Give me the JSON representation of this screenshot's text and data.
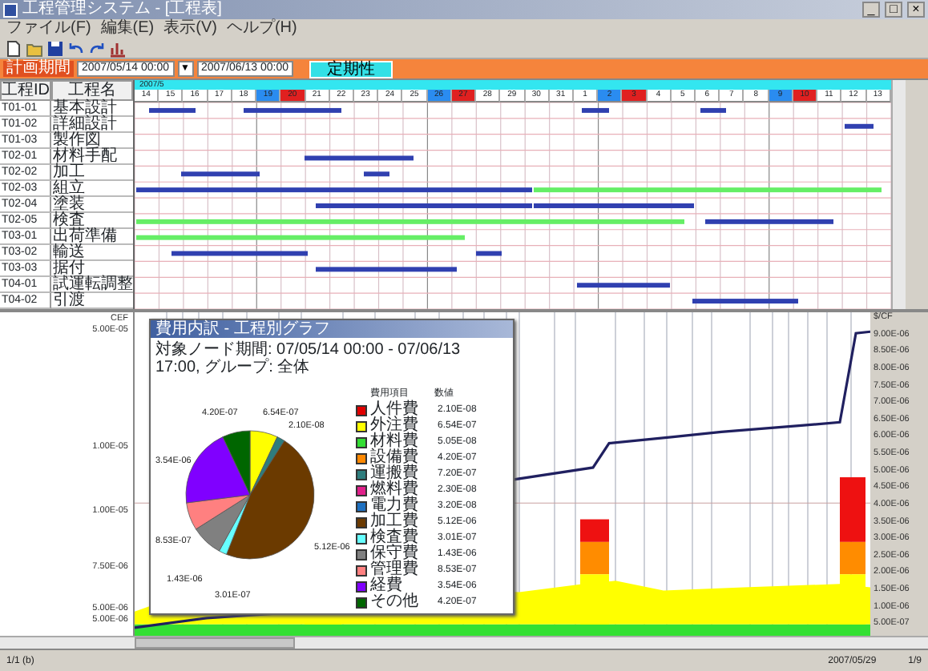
{
  "window": {
    "title": "工程管理システム - [工程表]",
    "controls": [
      "_",
      "□",
      "×"
    ]
  },
  "menu": [
    "ファイル(F)",
    "編集(E)",
    "表示(V)",
    "ヘルプ(H)"
  ],
  "filter_bar": {
    "label": "計画期間",
    "from": "2007/05/14 00:00",
    "dropdown": "▼",
    "to": "2007/06/13 00:00",
    "button": "定期性"
  },
  "gantt": {
    "columns": [
      "工程ID",
      "工程名"
    ],
    "month": "2007/5",
    "days": [
      {
        "label": "14",
        "kind": "weekday"
      },
      {
        "label": "15",
        "kind": "weekday"
      },
      {
        "label": "16",
        "kind": "weekday"
      },
      {
        "label": "17",
        "kind": "weekday"
      },
      {
        "label": "18",
        "kind": "weekday"
      },
      {
        "label": "19",
        "kind": "saturday"
      },
      {
        "label": "20",
        "kind": "sunday"
      },
      {
        "label": "21",
        "kind": "weekday"
      },
      {
        "label": "22",
        "kind": "weekday"
      },
      {
        "label": "23",
        "kind": "weekday"
      },
      {
        "label": "24",
        "kind": "weekday"
      },
      {
        "label": "25",
        "kind": "weekday"
      },
      {
        "label": "26",
        "kind": "saturday"
      },
      {
        "label": "27",
        "kind": "sunday"
      },
      {
        "label": "28",
        "kind": "weekday"
      },
      {
        "label": "29",
        "kind": "weekday"
      },
      {
        "label": "30",
        "kind": "weekday"
      },
      {
        "label": "31",
        "kind": "weekday"
      },
      {
        "label": "1",
        "kind": "weekday"
      },
      {
        "label": "2",
        "kind": "saturday"
      },
      {
        "label": "3",
        "kind": "sunday"
      },
      {
        "label": "4",
        "kind": "weekday"
      },
      {
        "label": "5",
        "kind": "weekday"
      },
      {
        "label": "6",
        "kind": "weekday"
      },
      {
        "label": "7",
        "kind": "weekday"
      },
      {
        "label": "8",
        "kind": "weekday"
      },
      {
        "label": "9",
        "kind": "saturday"
      },
      {
        "label": "10",
        "kind": "sunday"
      },
      {
        "label": "11",
        "kind": "weekday"
      },
      {
        "label": "12",
        "kind": "weekday"
      },
      {
        "label": "13",
        "kind": "weekday"
      }
    ],
    "rows": [
      {
        "id": "T01-01",
        "name": "基本設計"
      },
      {
        "id": "T01-02",
        "name": "詳細設計"
      },
      {
        "id": "T01-03",
        "name": "製作図"
      },
      {
        "id": "T02-01",
        "name": "材料手配"
      },
      {
        "id": "T02-02",
        "name": "加工"
      },
      {
        "id": "T02-03",
        "name": "組立"
      },
      {
        "id": "T02-04",
        "name": "塗装"
      },
      {
        "id": "T02-05",
        "name": "検査"
      },
      {
        "id": "T03-01",
        "name": "出荷準備"
      },
      {
        "id": "T03-02",
        "name": "輸送"
      },
      {
        "id": "T03-03",
        "name": "据付"
      },
      {
        "id": "T04-01",
        "name": "試運転調整"
      },
      {
        "id": "T04-02",
        "name": "引渡"
      }
    ]
  },
  "cost_chart": {
    "left_heading": "CEF",
    "left_ticks": [
      "5.00E-05",
      "1.00E-05",
      "1.00E-05",
      "7.50E-06",
      "5.00E-06",
      "5.00E-06"
    ],
    "right_heading": "$/CF",
    "right_ticks": [
      "9.00E-06",
      "8.50E-06",
      "8.00E-06",
      "7.50E-06",
      "7.00E-06",
      "6.50E-06",
      "6.00E-06",
      "5.50E-06",
      "5.00E-06",
      "4.50E-06",
      "4.00E-06",
      "3.50E-06",
      "3.00E-06",
      "2.50E-06",
      "2.00E-06",
      "1.50E-06",
      "1.00E-06",
      "5.00E-07"
    ]
  },
  "popup": {
    "title": "費用内訳 - 工程別グラフ",
    "subtitle": "対象ノード期間: 07/05/14 00:00 - 07/06/13 17:00, グループ: 全体",
    "pie_labels": [
      "4.20E-07",
      "6.54E-07",
      "2.10E-08",
      "3.54E-06",
      "8.53E-07",
      "1.43E-06",
      "3.01E-07",
      "5.12E-06"
    ],
    "legend_headers": [
      "費用項目",
      "数値"
    ],
    "legend": [
      {
        "name": "人件費",
        "value": "2.10E-08",
        "color": "#e00000"
      },
      {
        "name": "外注費",
        "value": "6.54E-07",
        "color": "#ffff00"
      },
      {
        "name": "材料費",
        "value": "5.05E-08",
        "color": "#33dd33"
      },
      {
        "name": "設備費",
        "value": "4.20E-07",
        "color": "#ff8800"
      },
      {
        "name": "運搬費",
        "value": "7.20E-07",
        "color": "#2e7d7d"
      },
      {
        "name": "燃料費",
        "value": "2.30E-08",
        "color": "#e0208a"
      },
      {
        "name": "電力費",
        "value": "3.20E-08",
        "color": "#1e70c0"
      },
      {
        "name": "加工費",
        "value": "5.12E-06",
        "color": "#6b3a00"
      },
      {
        "name": "検査費",
        "value": "3.01E-07",
        "color": "#66ffff"
      },
      {
        "name": "保守費",
        "value": "1.43E-06",
        "color": "#808080"
      },
      {
        "name": "管理費",
        "value": "8.53E-07",
        "color": "#ff8080"
      },
      {
        "name": "経費",
        "value": "3.54E-06",
        "color": "#8000ff"
      },
      {
        "name": "その他",
        "value": "4.20E-07",
        "color": "#006600"
      }
    ]
  },
  "status_bar": {
    "left": "1/1 (b)",
    "date": "2007/05/29",
    "page": "1/9"
  }
}
